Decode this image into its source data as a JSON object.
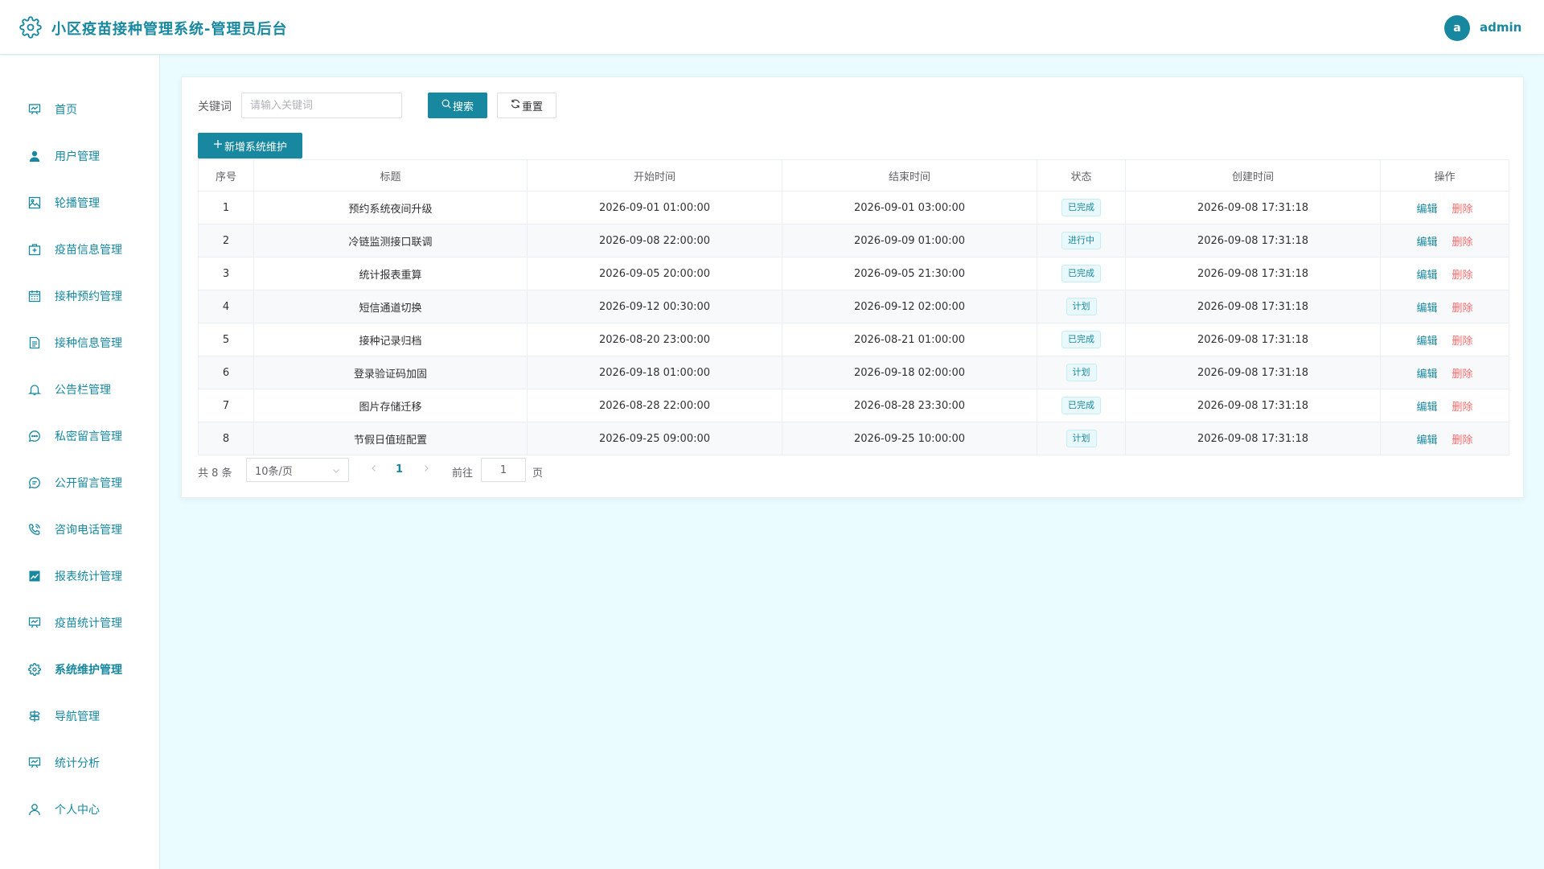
{
  "header": {
    "title": "小区疫苗接种管理系统-管理员后台",
    "avatar_letter": "a",
    "username": "admin"
  },
  "sidebar": {
    "items": [
      {
        "label": "首页",
        "icon": "dashboard-icon"
      },
      {
        "label": "用户管理",
        "icon": "user-icon"
      },
      {
        "label": "轮播管理",
        "icon": "image-icon"
      },
      {
        "label": "疫苗信息管理",
        "icon": "first-aid-kit-icon"
      },
      {
        "label": "接种预约管理",
        "icon": "calendar-icon"
      },
      {
        "label": "接种信息管理",
        "icon": "document-icon"
      },
      {
        "label": "公告栏管理",
        "icon": "bell-icon"
      },
      {
        "label": "私密留言管理",
        "icon": "chat-dots-icon"
      },
      {
        "label": "公开留言管理",
        "icon": "chat-lines-icon"
      },
      {
        "label": "咨询电话管理",
        "icon": "phone-icon"
      },
      {
        "label": "报表统计管理",
        "icon": "chart-icon"
      },
      {
        "label": "疫苗统计管理",
        "icon": "board-icon"
      },
      {
        "label": "系统维护管理",
        "icon": "gear-icon",
        "active": true
      },
      {
        "label": "导航管理",
        "icon": "guide-icon"
      },
      {
        "label": "统计分析",
        "icon": "board-icon"
      },
      {
        "label": "个人中心",
        "icon": "person-icon"
      }
    ]
  },
  "search": {
    "label": "关键词",
    "placeholder": "请输入关键词",
    "search_button": "搜索",
    "reset_button": "重置",
    "add_button": "新增系统维护"
  },
  "table": {
    "headers": [
      "序号",
      "标题",
      "开始时间",
      "结束时间",
      "状态",
      "创建时间",
      "操作"
    ],
    "edit_label": "编辑",
    "delete_label": "删除",
    "rows": [
      {
        "index": "1",
        "title": "预约系统夜间升级",
        "start": "2026-09-01 01:00:00",
        "end": "2026-09-01 03:00:00",
        "status": "已完成",
        "created": "2026-09-08 17:31:18"
      },
      {
        "index": "2",
        "title": "冷链监测接口联调",
        "start": "2026-09-08 22:00:00",
        "end": "2026-09-09 01:00:00",
        "status": "进行中",
        "created": "2026-09-08 17:31:18"
      },
      {
        "index": "3",
        "title": "统计报表重算",
        "start": "2026-09-05 20:00:00",
        "end": "2026-09-05 21:30:00",
        "status": "已完成",
        "created": "2026-09-08 17:31:18"
      },
      {
        "index": "4",
        "title": "短信通道切换",
        "start": "2026-09-12 00:30:00",
        "end": "2026-09-12 02:00:00",
        "status": "计划",
        "created": "2026-09-08 17:31:18"
      },
      {
        "index": "5",
        "title": "接种记录归档",
        "start": "2026-08-20 23:00:00",
        "end": "2026-08-21 01:00:00",
        "status": "已完成",
        "created": "2026-09-08 17:31:18"
      },
      {
        "index": "6",
        "title": "登录验证码加固",
        "start": "2026-09-18 01:00:00",
        "end": "2026-09-18 02:00:00",
        "status": "计划",
        "created": "2026-09-08 17:31:18"
      },
      {
        "index": "7",
        "title": "图片存储迁移",
        "start": "2026-08-28 22:00:00",
        "end": "2026-08-28 23:30:00",
        "status": "已完成",
        "created": "2026-09-08 17:31:18"
      },
      {
        "index": "8",
        "title": "节假日值班配置",
        "start": "2026-09-25 09:00:00",
        "end": "2026-09-25 10:00:00",
        "status": "计划",
        "created": "2026-09-08 17:31:18"
      }
    ]
  },
  "pagination": {
    "total": "共 8 条",
    "page_size": "10条/页",
    "current_page": "1",
    "goto_label": "前往",
    "goto_value": "1",
    "page_suffix": "页"
  },
  "colors": {
    "accent": "#17889f",
    "danger": "#f56c6c",
    "background": "#eafcff"
  }
}
